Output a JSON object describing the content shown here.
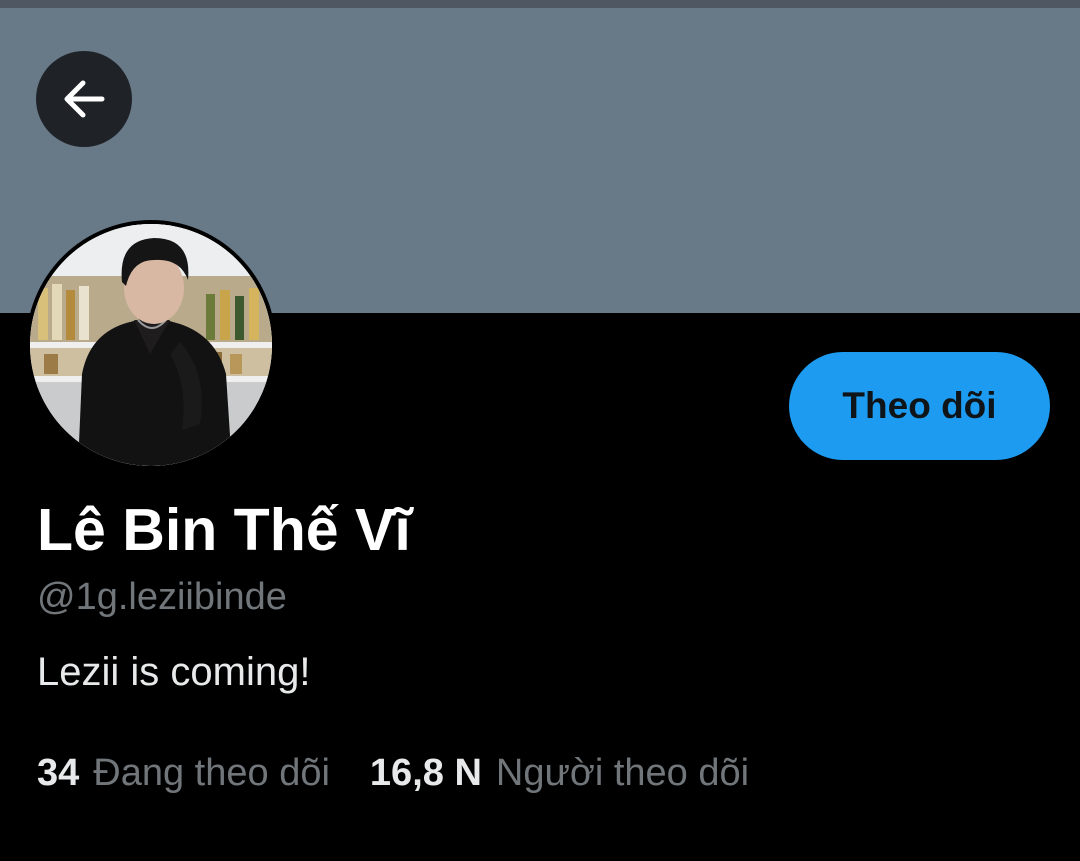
{
  "colors": {
    "banner": "#687988",
    "background": "#000000",
    "accent": "#1d9bf0",
    "muted_text": "#71767b",
    "primary_text": "#e7e9ea"
  },
  "header": {
    "back_icon": "arrow-left-icon"
  },
  "profile": {
    "display_name": "Lê Bin Thế Vĩ",
    "handle": "@1g.leziibinde",
    "bio": "Lezii is coming!",
    "follow_button_label": "Theo dõi"
  },
  "stats": {
    "following_count": "34",
    "following_label": "Đang theo dõi",
    "followers_count": "16,8 N",
    "followers_label": "Người theo dõi"
  }
}
